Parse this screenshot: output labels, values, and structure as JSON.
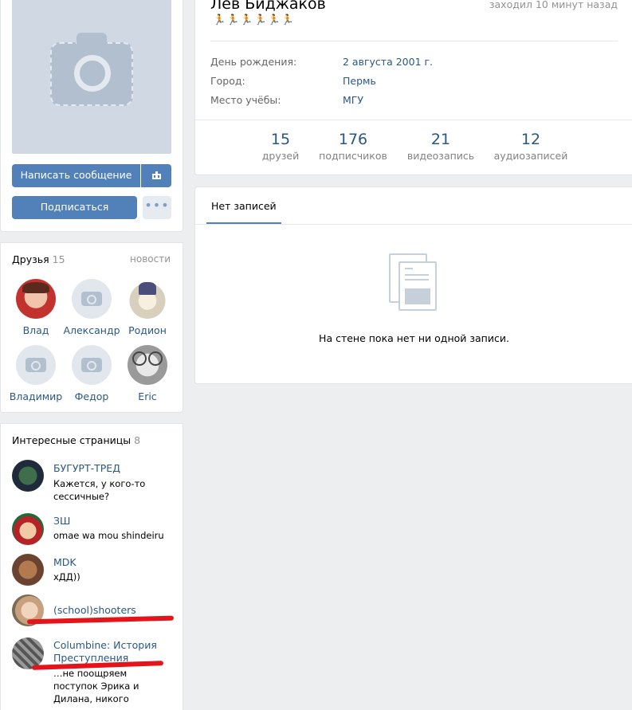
{
  "profile": {
    "name": "Лев Биджаков",
    "online": "заходил 10 минут назад",
    "status": "🏃🏃🏃🏃🏃🏃",
    "info": [
      {
        "label": "День рождения:",
        "value": "2 августа 2001 г."
      },
      {
        "label": "Город:",
        "value": "Пермь"
      },
      {
        "label": "Место учёбы:",
        "value": "МГУ"
      }
    ],
    "counters": [
      {
        "num": "15",
        "caption": "друзей"
      },
      {
        "num": "176",
        "caption": "подписчиков"
      },
      {
        "num": "21",
        "caption": "видеозапись"
      },
      {
        "num": "12",
        "caption": "аудиозаписей"
      }
    ]
  },
  "actions": {
    "message": "Написать сообщение",
    "subscribe": "Подписаться",
    "more": "•••"
  },
  "friends": {
    "title": "Друзья",
    "count": "15",
    "link": "новости",
    "items": [
      {
        "name": "Влад"
      },
      {
        "name": "Александр"
      },
      {
        "name": "Родион"
      },
      {
        "name": "Владимир"
      },
      {
        "name": "Федор"
      },
      {
        "name": "Eric"
      }
    ]
  },
  "pages": {
    "title": "Интересные страницы",
    "count": "8",
    "items": [
      {
        "title": "БУГУРТ-ТРЕД",
        "sub": "Кажется, у кого-то сессичные?"
      },
      {
        "title": "ЗШ",
        "sub": "omae wa mou shindeiru"
      },
      {
        "title": "MDK",
        "sub": "хДД))"
      },
      {
        "title": "(school)shooters",
        "sub": ""
      },
      {
        "title": "Columbine: История Преступления",
        "sub": "…не поощряем поступок Эрика и Дилана, никого"
      }
    ]
  },
  "wall": {
    "tab": "Нет записей",
    "empty": "На стене пока нет ни одной записи."
  },
  "colors": {
    "accent": "#5181b8",
    "link": "#2a5885",
    "background": "#edeef0",
    "scribble": "#e4141a"
  }
}
